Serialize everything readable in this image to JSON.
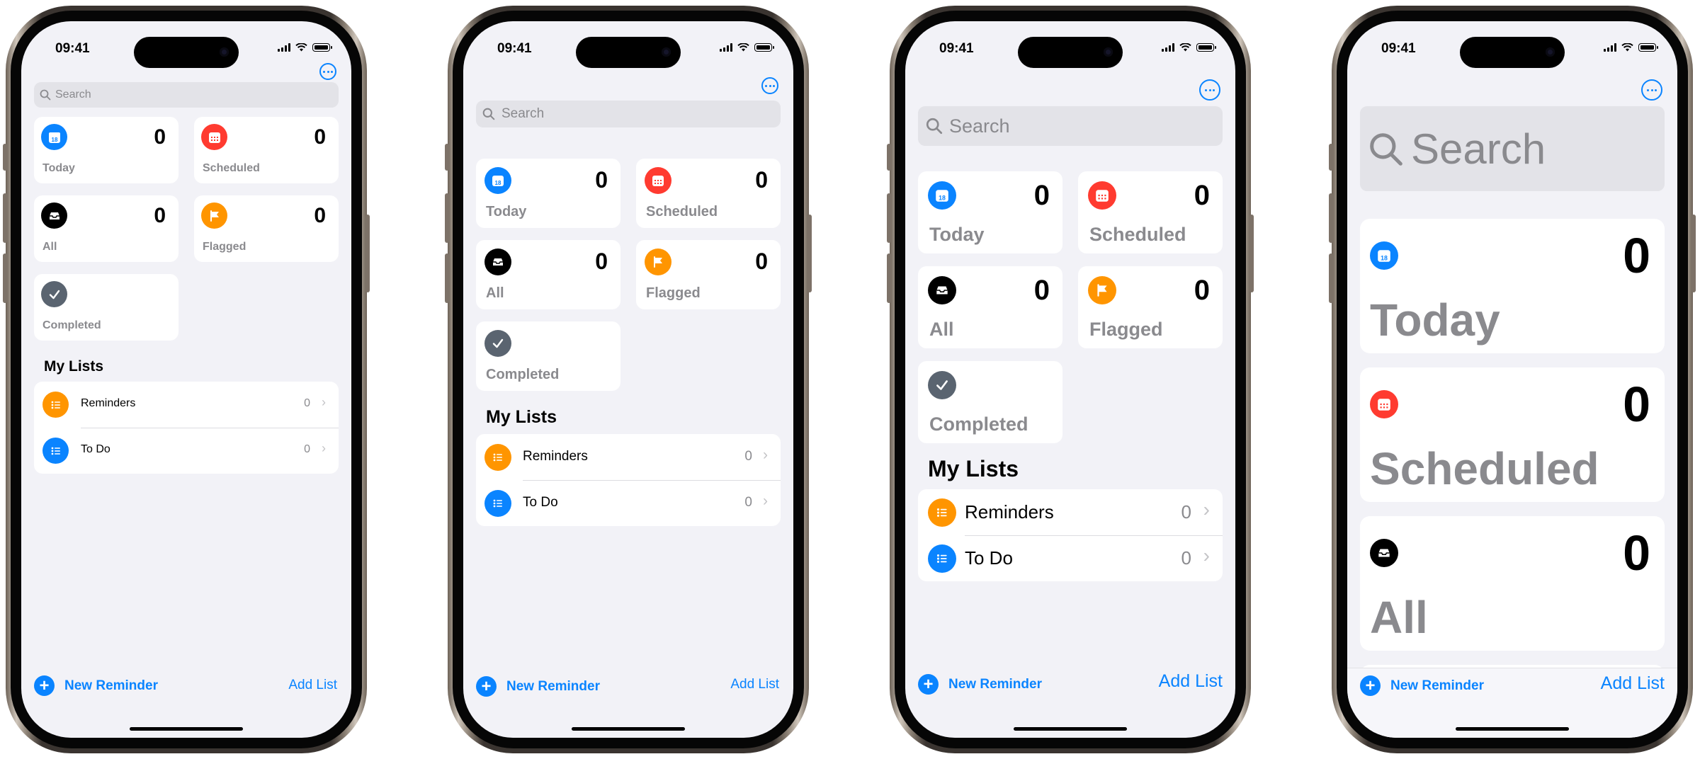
{
  "status_bar": {
    "time": "09:41"
  },
  "search": {
    "placeholder": "Search"
  },
  "smart_lists": {
    "today": {
      "label": "Today",
      "count": "0",
      "color": "#0a84ff",
      "icon": "calendar-icon"
    },
    "scheduled": {
      "label": "Scheduled",
      "count": "0",
      "color": "#ff3b30",
      "icon": "calendar-grid-icon"
    },
    "all": {
      "label": "All",
      "count": "0",
      "color": "#000000",
      "icon": "tray-icon"
    },
    "flagged": {
      "label": "Flagged",
      "count": "0",
      "color": "#ff9500",
      "icon": "flag-icon"
    },
    "completed": {
      "label": "Completed",
      "color": "#5a6470",
      "icon": "checkmark-icon"
    }
  },
  "my_lists": {
    "title": "My Lists",
    "items": [
      {
        "name": "Reminders",
        "count": "0",
        "color": "#ff9500",
        "icon": "list-bullet-icon"
      },
      {
        "name": "To Do",
        "count": "0",
        "color": "#0a84ff",
        "icon": "list-bullet-icon"
      }
    ]
  },
  "toolbar": {
    "new_reminder": "New Reminder",
    "add_list": "Add List"
  },
  "calendar_day": "18",
  "accent_color": "#0a84ff"
}
